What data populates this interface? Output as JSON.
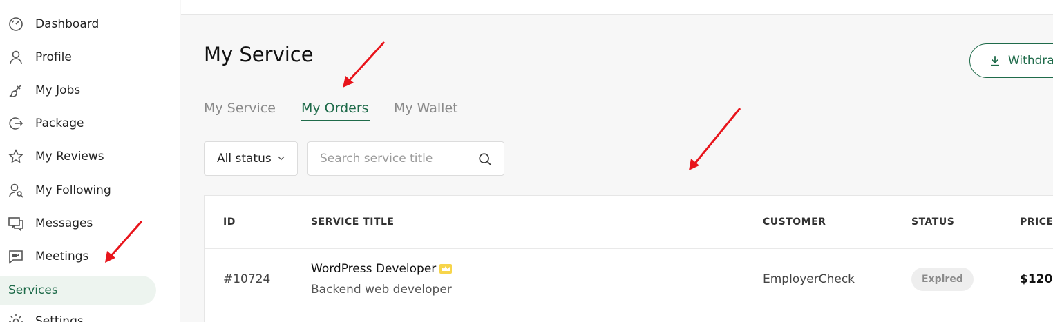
{
  "sidebar": {
    "items": [
      {
        "label": "Dashboard",
        "icon": "speedometer-icon"
      },
      {
        "label": "Profile",
        "icon": "user-icon"
      },
      {
        "label": "My Jobs",
        "icon": "brush-icon"
      },
      {
        "label": "Package",
        "icon": "logout-circle-icon"
      },
      {
        "label": "My Reviews",
        "icon": "star-icon"
      },
      {
        "label": "My Following",
        "icon": "user-search-icon"
      },
      {
        "label": "Messages",
        "icon": "chat-icon"
      },
      {
        "label": "Meetings",
        "icon": "video-message-icon"
      },
      {
        "label": "Services",
        "icon": ""
      },
      {
        "label": "Settings",
        "icon": "gear-icon"
      }
    ],
    "active": "Services"
  },
  "header": {
    "title": "My Service",
    "withdraw_label": "Withdraw"
  },
  "tabs": [
    {
      "label": "My Service"
    },
    {
      "label": "My Orders"
    },
    {
      "label": "My Wallet"
    }
  ],
  "active_tab": "My Orders",
  "filters": {
    "status_value": "All status",
    "search_placeholder": "Search service title"
  },
  "table": {
    "columns": [
      "ID",
      "SERVICE TITLE",
      "CUSTOMER",
      "STATUS",
      "PRICE"
    ],
    "rows": [
      {
        "id": "#10724",
        "title": "WordPress Developer",
        "subtitle": "Backend web developer",
        "customer": "EmployerCheck",
        "status": "Expired",
        "price": "$120"
      }
    ]
  },
  "colors": {
    "accent": "#1f6b4a",
    "annotation": "#e8141b"
  }
}
